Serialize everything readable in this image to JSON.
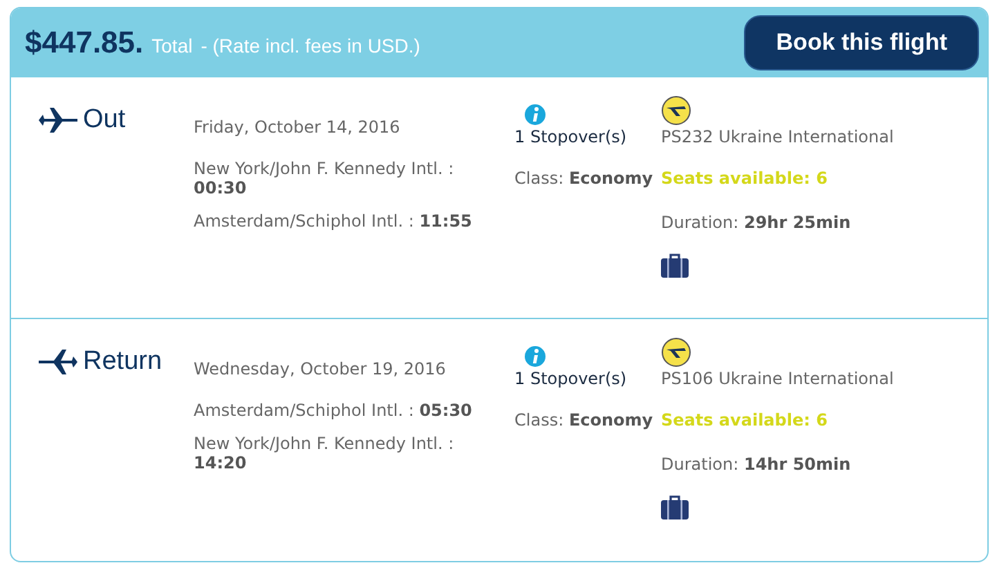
{
  "header": {
    "price": "$447.85.",
    "total_label": "Total",
    "rate_note": "- (Rate incl. fees in USD.)",
    "book_button": "Book this flight"
  },
  "legs": [
    {
      "kind": "out",
      "label": "Out",
      "date": "Friday, October 14, 2016",
      "stops": [
        {
          "place": "New York/John F. Kennedy Intl. :",
          "time": "00:30"
        },
        {
          "place": "Amsterdam/Schiphol Intl. :",
          "time": "11:55"
        }
      ],
      "stopover": "1 Stopover(s)",
      "class_label": "Class:",
      "class_value": "Economy",
      "flight": "PS232 Ukraine International",
      "seats": "Seats available: 6",
      "duration_label": "Duration:",
      "duration_value": "29hr 25min"
    },
    {
      "kind": "return",
      "label": "Return",
      "date": "Wednesday, October 19, 2016",
      "stops": [
        {
          "place": "Amsterdam/Schiphol Intl. :",
          "time": "05:30"
        },
        {
          "place": "New York/John F. Kennedy Intl. :",
          "time": "14:20"
        }
      ],
      "stopover": "1 Stopover(s)",
      "class_label": "Class:",
      "class_value": "Economy",
      "flight": "PS106 Ukraine International",
      "seats": "Seats available: 6",
      "duration_label": "Duration:",
      "duration_value": "14hr 50min"
    }
  ]
}
